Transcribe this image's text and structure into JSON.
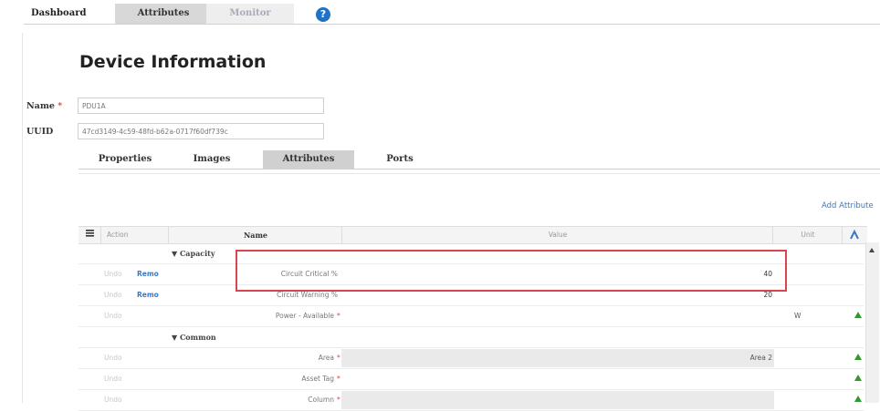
{
  "top_tabs": {
    "dashboard": "Dashboard",
    "attributes": "Attributes",
    "monitor": "Monitor",
    "help": "?"
  },
  "page_title": "Device Information",
  "form": {
    "name_label": "Name",
    "required_mark": "*",
    "name_value": "PDU1A",
    "uuid_label": "UUID",
    "uuid_value": "47cd3149-4c59-48fd-b62a-0717f60df739c"
  },
  "inner_tabs": [
    "Properties",
    "Images",
    "Attributes",
    "Ports"
  ],
  "add_attribute_label": "Add Attribute",
  "table": {
    "headers": {
      "action": "Action",
      "name": "Name",
      "value": "Value",
      "unit": "Unit"
    },
    "rows": [
      {
        "type": "group",
        "name": "▼ Capacity"
      },
      {
        "type": "item",
        "undo": "Undo",
        "remove": "Remo",
        "name": "Circuit Critical %",
        "required": "",
        "value": "40",
        "unit": ""
      },
      {
        "type": "item",
        "undo": "Undo",
        "remove": "Remo",
        "name": "Circuit Warning %",
        "required": "",
        "value": "20",
        "unit": ""
      },
      {
        "type": "item",
        "undo": "Undo",
        "remove": "",
        "name": "Power - Available",
        "required": "*",
        "value": "",
        "unit": "W"
      },
      {
        "type": "group",
        "name": "▼ Common"
      },
      {
        "type": "item",
        "undo": "Undo",
        "remove": "",
        "name": "Area",
        "required": "*",
        "value": "Area 2",
        "unit": ""
      },
      {
        "type": "item",
        "undo": "Undo",
        "remove": "",
        "name": "Asset Tag",
        "required": "*",
        "value": "",
        "unit": ""
      },
      {
        "type": "item",
        "undo": "Undo",
        "remove": "",
        "name": "Column",
        "required": "*",
        "value": "",
        "unit": ""
      }
    ]
  },
  "colors": {
    "accent": "#3a79c8",
    "highlight_border": "#d9454e",
    "arrow": "#2e9a2e"
  }
}
